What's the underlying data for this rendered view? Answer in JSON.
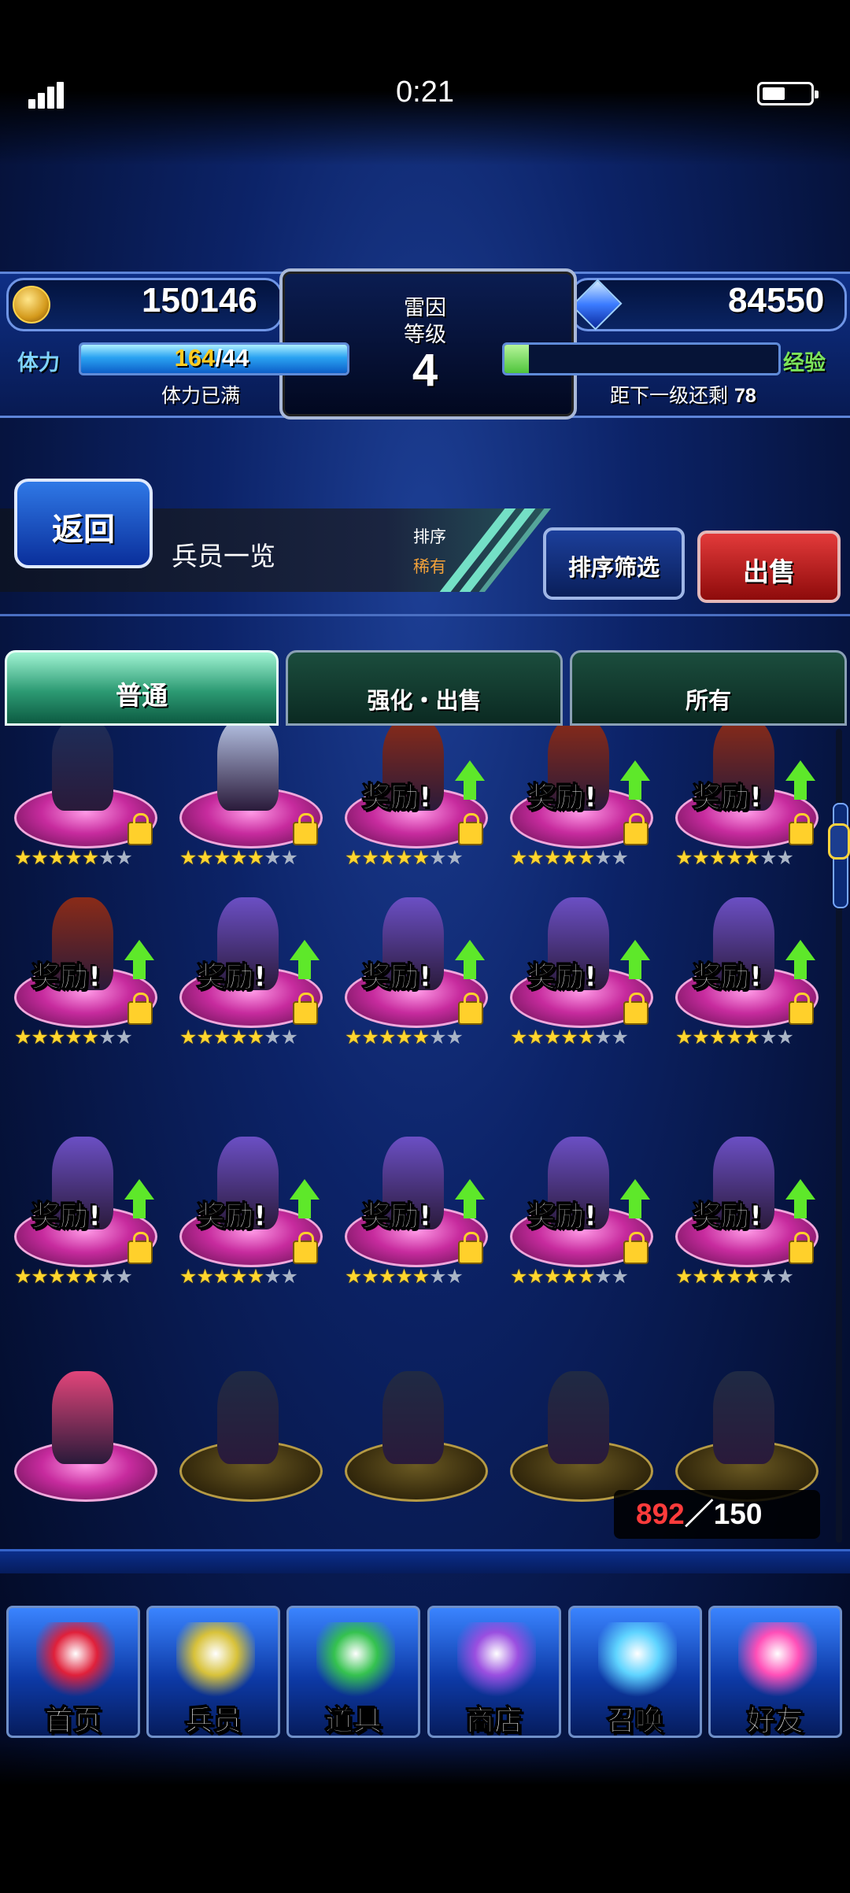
{
  "status_bar": {
    "time": "0:21"
  },
  "header": {
    "gold": "150146",
    "crystals": "84550",
    "player_name": "雷因",
    "level_label": "等级",
    "level": "4",
    "stamina_label": "体力",
    "stamina_current": "164",
    "stamina_max": "/44",
    "stamina_status": "体力已满",
    "stamina_fill": 1.0,
    "exp_label": "经验",
    "exp_fill": 0.09,
    "exp_remaining_label": "距下一级还剩",
    "exp_remaining": "78"
  },
  "nav": {
    "back_label": "返回",
    "page_title": "兵员一览",
    "sort_label": "排序",
    "sort_value": "稀有",
    "sort_filter_label": "排序筛选",
    "sell_label": "出售"
  },
  "tabs": [
    {
      "label": "普通",
      "active": true
    },
    {
      "label": "强化・出售",
      "active": false
    },
    {
      "label": "所有",
      "active": false
    }
  ],
  "units": {
    "reward_text": "奖励!",
    "rows": [
      [
        {
          "type": "witch",
          "stars": 5,
          "max_stars": 7,
          "reward": false,
          "locked": true,
          "color": "#1d2e5a"
        },
        {
          "type": "maid",
          "stars": 5,
          "max_stars": 7,
          "reward": false,
          "locked": true,
          "color": "#b9c7e8"
        },
        {
          "type": "mage",
          "stars": 5,
          "max_stars": 7,
          "reward": true,
          "locked": true,
          "color": "#8a2b18"
        },
        {
          "type": "mage",
          "stars": 5,
          "max_stars": 7,
          "reward": true,
          "locked": true,
          "color": "#8a2b18"
        },
        {
          "type": "mage",
          "stars": 5,
          "max_stars": 7,
          "reward": true,
          "locked": true,
          "color": "#8a2b18"
        }
      ],
      [
        {
          "type": "mage",
          "stars": 5,
          "max_stars": 7,
          "reward": true,
          "locked": true,
          "color": "#8a2b18"
        },
        {
          "type": "swordsman",
          "stars": 5,
          "max_stars": 7,
          "reward": true,
          "locked": true,
          "color": "#6b4fc4"
        },
        {
          "type": "swordsman",
          "stars": 5,
          "max_stars": 7,
          "reward": true,
          "locked": true,
          "color": "#6b4fc4"
        },
        {
          "type": "swordsman",
          "stars": 5,
          "max_stars": 7,
          "reward": true,
          "locked": true,
          "color": "#6b4fc4"
        },
        {
          "type": "swordsman",
          "stars": 5,
          "max_stars": 7,
          "reward": true,
          "locked": true,
          "color": "#6b4fc4"
        }
      ],
      [
        {
          "type": "swordsman",
          "stars": 5,
          "max_stars": 7,
          "reward": true,
          "locked": true,
          "color": "#6b4fc4"
        },
        {
          "type": "swordsman",
          "stars": 5,
          "max_stars": 7,
          "reward": true,
          "locked": true,
          "color": "#6b4fc4"
        },
        {
          "type": "swordsman",
          "stars": 5,
          "max_stars": 7,
          "reward": true,
          "locked": true,
          "color": "#6b4fc4"
        },
        {
          "type": "swordsman",
          "stars": 5,
          "max_stars": 7,
          "reward": true,
          "locked": true,
          "color": "#6b4fc4"
        },
        {
          "type": "swordsman",
          "stars": 5,
          "max_stars": 7,
          "reward": true,
          "locked": true,
          "color": "#6b4fc4"
        }
      ],
      [
        {
          "type": "princess",
          "stars": 0,
          "max_stars": 0,
          "reward": false,
          "locked": false,
          "color": "#e2457a"
        },
        {
          "type": "samurai",
          "stars": 0,
          "max_stars": 0,
          "reward": false,
          "locked": false,
          "color": "#1f2a44"
        },
        {
          "type": "samurai",
          "stars": 0,
          "max_stars": 0,
          "reward": false,
          "locked": false,
          "color": "#1f2a44"
        },
        {
          "type": "samurai",
          "stars": 0,
          "max_stars": 0,
          "reward": false,
          "locked": false,
          "color": "#1f2a44"
        },
        {
          "type": "samurai",
          "stars": 0,
          "max_stars": 0,
          "reward": false,
          "locked": false,
          "color": "#1f2a44"
        }
      ]
    ]
  },
  "unit_count": {
    "current": "892",
    "total": "／150"
  },
  "bottom_nav": [
    {
      "label": "首页",
      "icon": "sword-icon",
      "color": "#e0203a"
    },
    {
      "label": "兵员",
      "icon": "warrior-icon",
      "color": "#d8c23a"
    },
    {
      "label": "道具",
      "icon": "potion-icon",
      "color": "#35c24f"
    },
    {
      "label": "商店",
      "icon": "shop-icon",
      "color": "#9a4fe0"
    },
    {
      "label": "召唤",
      "icon": "crystal-icon",
      "color": "#5fd4ff"
    },
    {
      "label": "好友",
      "icon": "friends-icon",
      "color": "#ff4fb8"
    }
  ]
}
